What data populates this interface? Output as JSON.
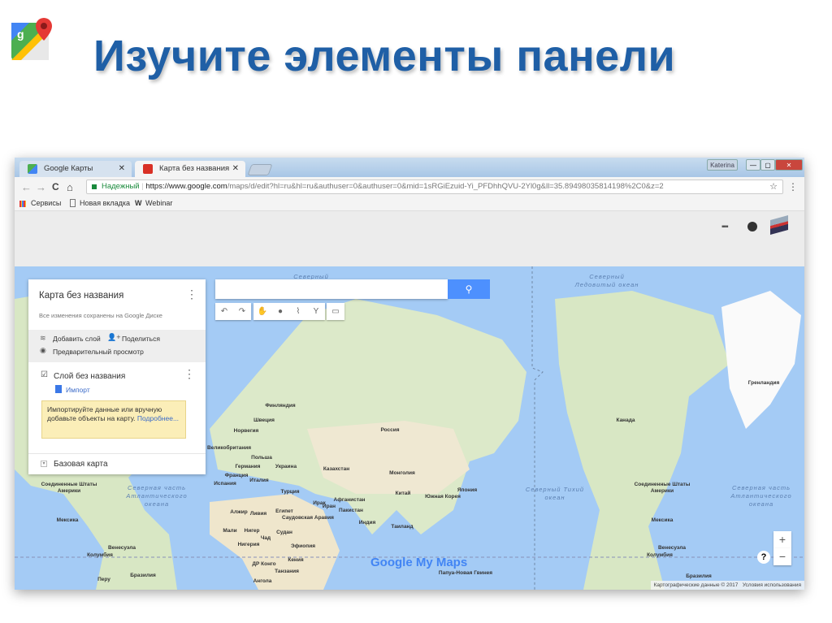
{
  "slide": {
    "title": "Изучите элементы панели"
  },
  "browser": {
    "tabs": [
      {
        "label": "Google Карты",
        "close": "✕"
      },
      {
        "label": "Карта без названия",
        "close": "✕"
      }
    ],
    "user": "Katerina",
    "window_controls": {
      "minimize": "—",
      "maximize": "▢",
      "close": "✕"
    },
    "nav": {
      "back": "←",
      "forward": "→",
      "reload": "C",
      "home": "⌂"
    },
    "address": {
      "secure_label": "Надежный",
      "host": "https://www.google.com",
      "path": "/maps/d/edit?hl=ru&hl=ru&authuser=0&authuser=0&mid=1sRGiEzuid-Yi_PFDhhQVU-2Yl0g&ll=35.89498035814198%2C0&z=2"
    },
    "star": "☆",
    "menu": "⋮",
    "bookmarks": [
      {
        "label": "Сервисы"
      },
      {
        "label": "Новая вкладка"
      },
      {
        "label": "Webinar",
        "icon": "W"
      }
    ]
  },
  "panel": {
    "map_title": "Карта без названия",
    "saved_status": "Все изменения сохранены на Google Диске",
    "add_layer": "Добавить слой",
    "share": "Поделиться",
    "preview": "Предварительный просмотр",
    "layer_name": "Слой без названия",
    "import": "Импорт",
    "tip_text": "Импортируйте данные или вручную добавьте объекты на карту.",
    "tip_link": "Подробнее...",
    "base_map": "Базовая карта"
  },
  "map": {
    "search_icon": "🔍",
    "zoom_in": "+",
    "zoom_out": "−",
    "help": "?",
    "logo": "Google My Maps",
    "attribution": "Картографические данные © 2017",
    "terms": "Условия использования",
    "oceans": [
      {
        "text": "Северный Ледовитый океан"
      },
      {
        "text": "Северный Ледовитый океан"
      },
      {
        "text": "Северная часть Атлантического океана"
      },
      {
        "text": "Северный Тихий океан"
      },
      {
        "text": "Северная часть Атлантического океана"
      }
    ],
    "labels": [
      "Россия",
      "Казахстан",
      "Монголия",
      "Китай",
      "Южная Корея",
      "Япония",
      "Афганистан",
      "Иран",
      "Ирак",
      "Пакистан",
      "Индия",
      "Таиланд",
      "Турция",
      "Саудовская Аравия",
      "Египет",
      "Ливия",
      "Алжир",
      "Мали",
      "Нигер",
      "Чад",
      "Судан",
      "Нигерия",
      "Эфиопия",
      "Кения",
      "ДР Конго",
      "Танзания",
      "Ангола",
      "Финляндия",
      "Швеция",
      "Норвегия",
      "Великобритания",
      "Польша",
      "Германия",
      "Украина",
      "Франция",
      "Италия",
      "Испания",
      "Канада",
      "Соединенные Штаты Америки",
      "Мексика",
      "Венесуэла",
      "Колумбия",
      "Перу",
      "Бразилия",
      "Гренландия",
      "Канада",
      "Соединенные Штаты Америки",
      "Мексика",
      "Венесуэла",
      "Колумбия",
      "Бразилия",
      "Папуа-Новая Гвинея"
    ]
  },
  "colors": {
    "title": "#1f5fa6",
    "ocean": "#a4cbf5",
    "search_button": "#4d90fe",
    "tip_bg": "#fbeeb8"
  }
}
